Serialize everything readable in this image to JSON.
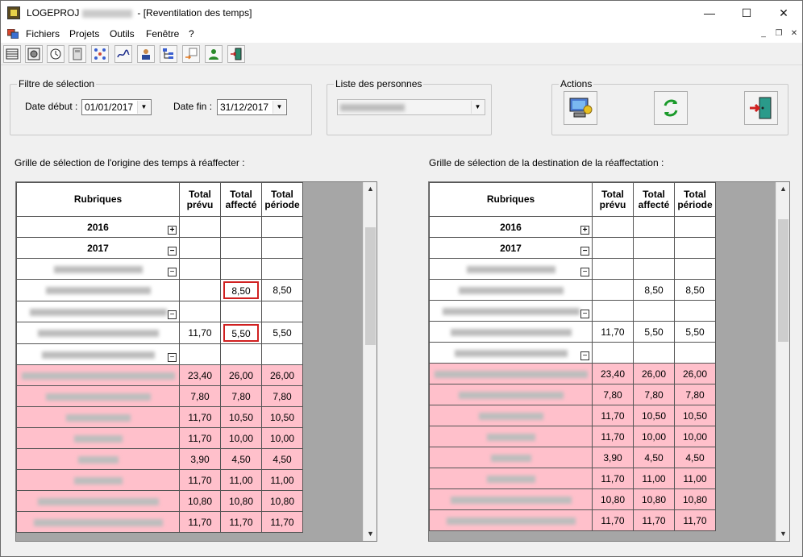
{
  "window": {
    "app_name": "LOGEPROJ",
    "title_rest": "- [Reventilation des temps]",
    "minimize_glyph": "—",
    "maximize_glyph": "☐",
    "close_glyph": "✕"
  },
  "menu": {
    "items": [
      "Fichiers",
      "Projets",
      "Outils",
      "Fenêtre",
      "?"
    ],
    "mdi_minimize": "_",
    "mdi_restore": "❐",
    "mdi_close": "✕"
  },
  "toolbar": {
    "icons": [
      "list-icon",
      "chart-icon",
      "clock-icon",
      "calculator-icon",
      "network-icon",
      "signature-icon",
      "users-icon",
      "tree-icon",
      "transfer-icon",
      "person-icon",
      "exit-icon"
    ]
  },
  "filter": {
    "legend": "Filtre de sélection",
    "date_debut_label": "Date début :",
    "date_debut_value": "01/01/2017",
    "date_fin_label": "Date fin :",
    "date_fin_value": "31/12/2017"
  },
  "persons": {
    "legend": "Liste des personnes"
  },
  "actions": {
    "legend": "Actions",
    "buttons": [
      "apply-icon",
      "refresh-icon",
      "exit-door-icon"
    ]
  },
  "left_grid": {
    "caption": "Grille de sélection de l'origine des temps à réaffecter :",
    "headers": [
      "Rubriques",
      "Total prévu",
      "Total affecté",
      "Total période"
    ]
  },
  "right_grid": {
    "caption": "Grille de sélection de la destination de la réaffectation :",
    "headers": [
      "Rubriques",
      "Total prévu",
      "Total affecté",
      "Total période"
    ]
  },
  "rows": [
    {
      "type": "year",
      "label": "2016",
      "expander": "+",
      "prevu": "",
      "affecte": "",
      "periode": "",
      "pink": false,
      "hl": false
    },
    {
      "type": "year",
      "label": "2017",
      "expander": "−",
      "prevu": "",
      "affecte": "",
      "periode": "",
      "pink": false,
      "hl": false
    },
    {
      "type": "group",
      "label": "",
      "expander": "−",
      "prevu": "",
      "affecte": "",
      "periode": "",
      "pink": false,
      "hl": false
    },
    {
      "type": "item",
      "label": "",
      "expander": "",
      "prevu": "",
      "affecte": "8,50",
      "periode": "8,50",
      "pink": false,
      "hl": true
    },
    {
      "type": "group",
      "label": "",
      "expander": "−",
      "prevu": "",
      "affecte": "",
      "periode": "",
      "pink": false,
      "hl": false
    },
    {
      "type": "item",
      "label": "",
      "expander": "",
      "prevu": "11,70",
      "affecte": "5,50",
      "periode": "5,50",
      "pink": false,
      "hl": true
    },
    {
      "type": "group",
      "label": "",
      "expander": "−",
      "prevu": "",
      "affecte": "",
      "periode": "",
      "pink": false,
      "hl": false
    },
    {
      "type": "item",
      "label": "",
      "expander": "",
      "prevu": "23,40",
      "affecte": "26,00",
      "periode": "26,00",
      "pink": true,
      "hl": false
    },
    {
      "type": "item",
      "label": "",
      "expander": "",
      "prevu": "7,80",
      "affecte": "7,80",
      "periode": "7,80",
      "pink": true,
      "hl": false
    },
    {
      "type": "item",
      "label": "",
      "expander": "",
      "prevu": "11,70",
      "affecte": "10,50",
      "periode": "10,50",
      "pink": true,
      "hl": false
    },
    {
      "type": "item",
      "label": "",
      "expander": "",
      "prevu": "11,70",
      "affecte": "10,00",
      "periode": "10,00",
      "pink": true,
      "hl": false
    },
    {
      "type": "item",
      "label": "",
      "expander": "",
      "prevu": "3,90",
      "affecte": "4,50",
      "periode": "4,50",
      "pink": true,
      "hl": false
    },
    {
      "type": "item",
      "label": "",
      "expander": "",
      "prevu": "11,70",
      "affecte": "11,00",
      "periode": "11,00",
      "pink": true,
      "hl": false
    },
    {
      "type": "item",
      "label": "",
      "expander": "",
      "prevu": "10,80",
      "affecte": "10,80",
      "periode": "10,80",
      "pink": true,
      "hl": false
    },
    {
      "type": "item",
      "label": "",
      "expander": "",
      "prevu": "11,70",
      "affecte": "11,70",
      "periode": "11,70",
      "pink": true,
      "hl": false
    }
  ],
  "scrollbar": {
    "up_glyph": "▲",
    "down_glyph": "▼"
  },
  "colors": {
    "row_highlight": "#ffc0cb",
    "cell_selected_border": "#d02020",
    "grid_background": "#a6a6a6"
  }
}
